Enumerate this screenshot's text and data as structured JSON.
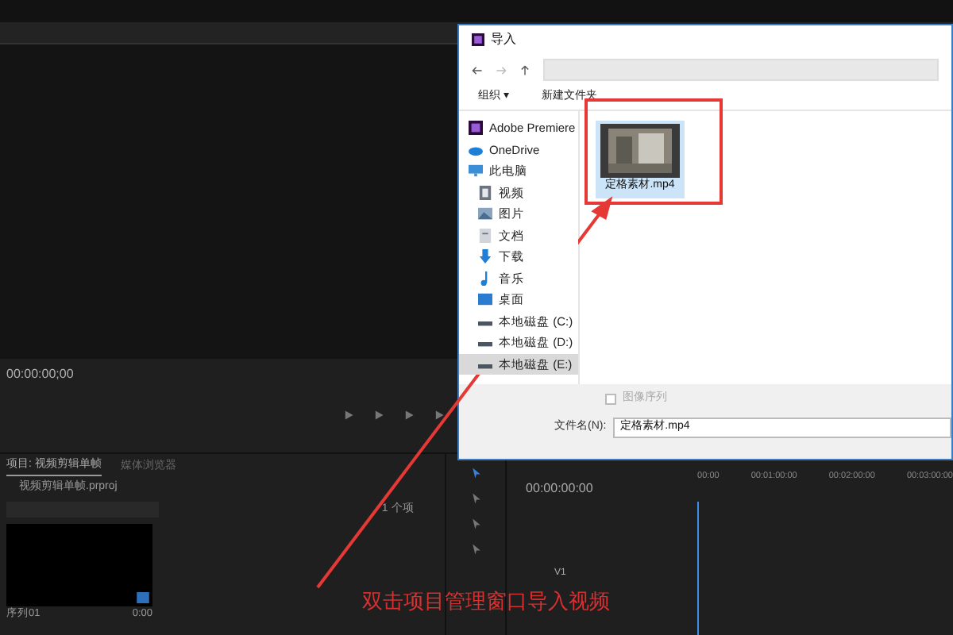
{
  "program_monitor": {
    "timecode": "00:00:00;00"
  },
  "project_panel": {
    "tabs": [
      {
        "label": "项目: 视频剪辑单帧",
        "selected": true
      },
      {
        "label": "媒体浏览器",
        "selected": false
      }
    ],
    "project_file": "视频剪辑单帧.prproj",
    "item_count": "1 个项",
    "items": [
      {
        "name": "序列01",
        "duration": "0:00"
      }
    ]
  },
  "timeline": {
    "timecode": "00:00:00:00",
    "ruler": [
      "00:00",
      "00:01:00:00",
      "00:02:00:00",
      "00:03:00:00"
    ],
    "tracks": [
      "V1"
    ]
  },
  "import_dialog": {
    "title": "导入",
    "toolbar": [
      {
        "label": "组织 ▾"
      },
      {
        "label": "新建文件夹"
      }
    ],
    "nav": [
      {
        "label": "Adobe Premiere",
        "kind": "app",
        "selected": false
      },
      {
        "label": "OneDrive",
        "kind": "cloud",
        "selected": false
      },
      {
        "label": "此电脑",
        "kind": "pc",
        "selected": false,
        "children": [
          {
            "label": "视频",
            "kind": "video",
            "selected": false
          },
          {
            "label": "图片",
            "kind": "picture",
            "selected": false
          },
          {
            "label": "文档",
            "kind": "doc",
            "selected": false
          },
          {
            "label": "下载",
            "kind": "download",
            "selected": false
          },
          {
            "label": "音乐",
            "kind": "music",
            "selected": false
          },
          {
            "label": "桌面",
            "kind": "desktop",
            "selected": false
          },
          {
            "label": "本地磁盘 (C:)",
            "kind": "drive",
            "selected": false
          },
          {
            "label": "本地磁盘 (D:)",
            "kind": "drive",
            "selected": false
          },
          {
            "label": "本地磁盘 (E:)",
            "kind": "drive",
            "selected": true
          }
        ]
      }
    ],
    "files": [
      {
        "name": "定格素材.mp4",
        "selected": true
      }
    ],
    "image_sequence": {
      "label": "图像序列",
      "checked": false
    },
    "filename": {
      "label": "文件名(N):",
      "value": "定格素材.mp4"
    }
  },
  "annotation": {
    "text": "双击项目管理窗口导入视频"
  }
}
